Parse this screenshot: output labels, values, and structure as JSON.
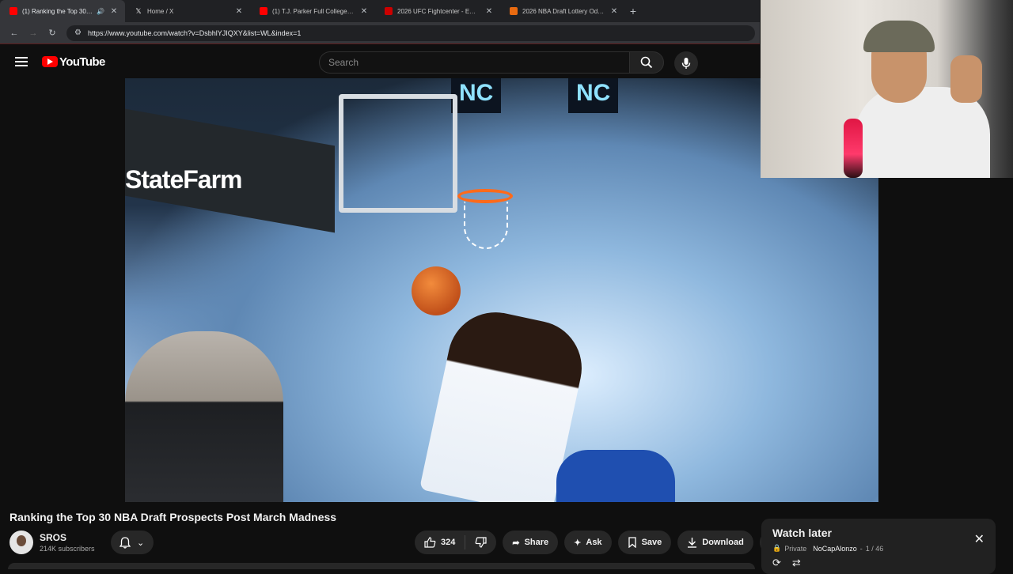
{
  "browser": {
    "tabs": [
      {
        "title": "(1) Ranking the Top 30 NBA",
        "favicon_color": "#ff0000",
        "active": true,
        "audio": true
      },
      {
        "title": "Home / X",
        "favicon_color": "#ffffff",
        "active": false
      },
      {
        "title": "(1) T.J. Parker Full College Footb",
        "favicon_color": "#ff0000",
        "active": false
      },
      {
        "title": "2026 UFC Fightcenter - ESPN",
        "favicon_color": "#cc0000",
        "active": false
      },
      {
        "title": "2026 NBA Draft Lottery Odds |",
        "favicon_color": "#e86a10",
        "active": false
      }
    ],
    "url": "https://www.youtube.com/watch?v=DsbhlYJIQXY&list=WL&index=1"
  },
  "youtube": {
    "logo_text": "YouTube",
    "search_placeholder": "Search"
  },
  "video": {
    "overlay_texts": {
      "banner": "StateFarm",
      "scoreboard_1": "NC",
      "scoreboard_2": "NC"
    }
  },
  "details": {
    "title": "Ranking the Top 30 NBA Draft Prospects Post March Madness",
    "channel_name": "SROS",
    "subscribers": "214K subscribers",
    "like_count": "324",
    "share_label": "Share",
    "ask_label": "Ask",
    "save_label": "Save",
    "download_label": "Download"
  },
  "playlist": {
    "title": "Watch later",
    "privacy": "Private",
    "owner": "NoCapAlonzo",
    "position": "1 / 46"
  },
  "colors": {
    "accent": "#ff0000",
    "background": "#0f0f0f"
  }
}
